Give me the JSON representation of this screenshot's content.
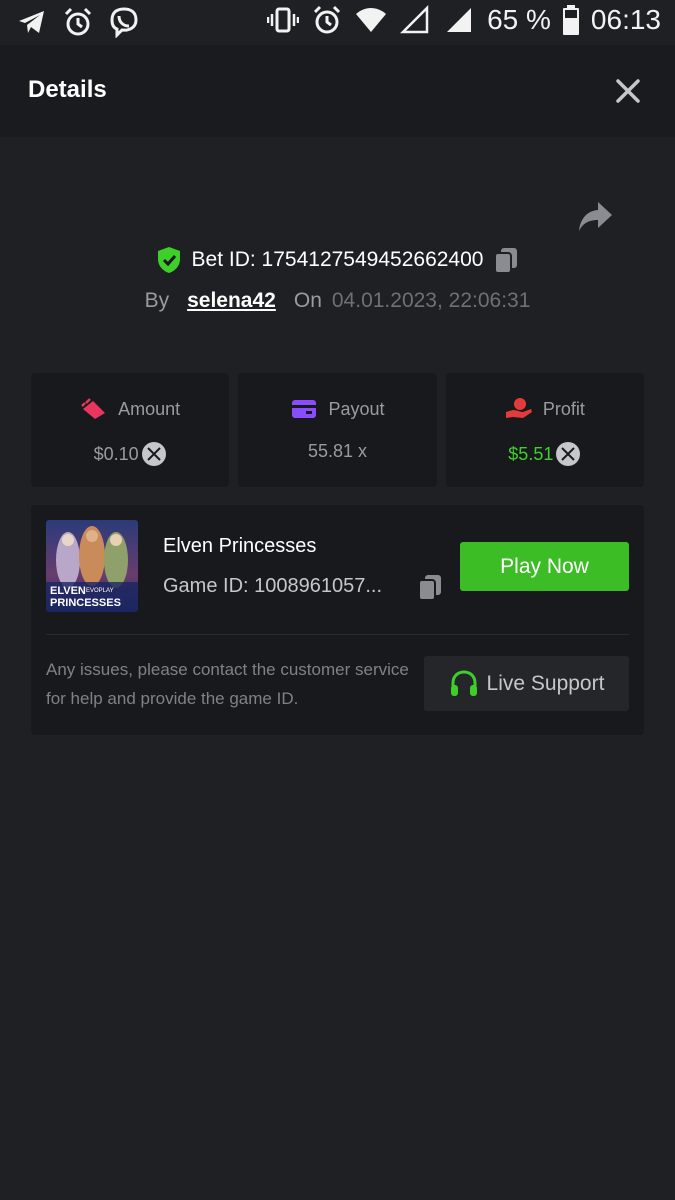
{
  "status_bar": {
    "battery": "65 %",
    "time": "06:13",
    "left_icons": [
      "telegram-icon",
      "alarm-icon",
      "viber-icon"
    ],
    "right_icons": [
      "vibrate-icon",
      "alarm-icon",
      "wifi-icon",
      "signal-empty-icon",
      "signal-icon",
      "battery-icon"
    ]
  },
  "header": {
    "title": "Details",
    "close_icon": "close-icon"
  },
  "bet": {
    "id_text": "Bet ID: 1754127549452662400",
    "by_label": "By",
    "username": "selena42",
    "on_label": "On",
    "datetime": "04.01.2023, 22:06:31",
    "verified_color": "#3ecf2a"
  },
  "stats": {
    "amount": {
      "label": "Amount",
      "value": "$0.10",
      "icon": "amount-icon",
      "icon_color": "#e8365d"
    },
    "payout": {
      "label": "Payout",
      "value": "55.81 x",
      "icon": "payout-card-icon",
      "icon_color": "#8a4cff"
    },
    "profit": {
      "label": "Profit",
      "value": "$5.51",
      "icon": "profit-hand-icon",
      "icon_color": "#e23b3b",
      "value_color": "#3ecf2a"
    }
  },
  "game": {
    "name": "Elven Princesses",
    "id_text": "Game ID: 1008961057...",
    "thumb_title_line1": "ELVEN",
    "thumb_title_line2": "PRINCESSES",
    "thumb_brand": "EVOPLAY",
    "play_label": "Play Now",
    "play_color": "#3dbd25"
  },
  "support": {
    "issues_text": "Any issues, please contact the customer service for help and provide the game ID.",
    "button_label": "Live Support",
    "icon": "headset-icon",
    "icon_color": "#3ecf2a"
  }
}
